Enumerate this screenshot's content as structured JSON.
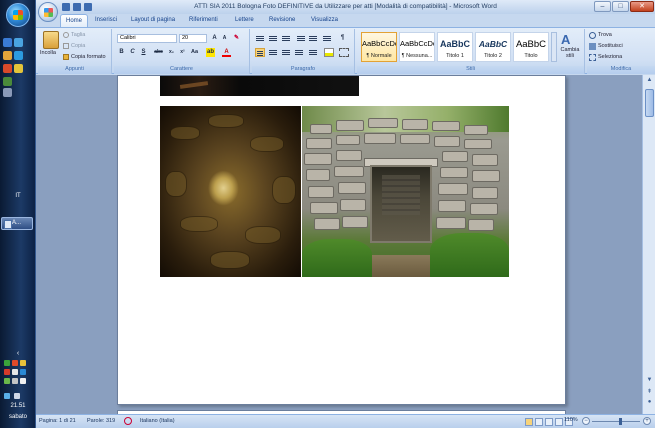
{
  "window": {
    "title": "ATTI SIA 2011 Bologna Foto DEFINITIVE da Utilizzare per atti [Modalità di compatibilità] - Microsoft Word"
  },
  "tabs": [
    "Home",
    "Inserisci",
    "Layout di pagina",
    "Riferimenti",
    "Lettere",
    "Revisione",
    "Visualizza"
  ],
  "ribbon": {
    "clipboard": {
      "paste": "Incolla",
      "cut": "Taglia",
      "copy": "Copia",
      "format_painter": "Copia formato",
      "label": "Appunti"
    },
    "font": {
      "name": "Calibri",
      "size": "20",
      "label": "Carattere"
    },
    "paragraph": {
      "label": "Paragrafo"
    },
    "styles": {
      "items": [
        {
          "preview": "AaBbCcDc",
          "name": "¶ Normale"
        },
        {
          "preview": "AaBbCcDc",
          "name": "¶ Nessuna..."
        },
        {
          "preview": "AaBbC",
          "name": "Titolo 1"
        },
        {
          "preview": "AaBbC",
          "name": "Titolo 2"
        },
        {
          "preview": "AaBbC",
          "name": "Titolo"
        }
      ],
      "change_styles": "Cambia stili",
      "label": "Stili"
    },
    "editing": {
      "find": "Trova",
      "replace": "Sostituisci",
      "select": "Seleziona",
      "label": "Modifica"
    }
  },
  "status": {
    "page": "Pagina: 1 di 21",
    "words": "Parole: 319",
    "language": "Italiano (Italia)",
    "zoom": "110%"
  },
  "taskbar": {
    "task_label": "A...",
    "time": "21.51",
    "day": "sabato",
    "side_label": "IT"
  }
}
